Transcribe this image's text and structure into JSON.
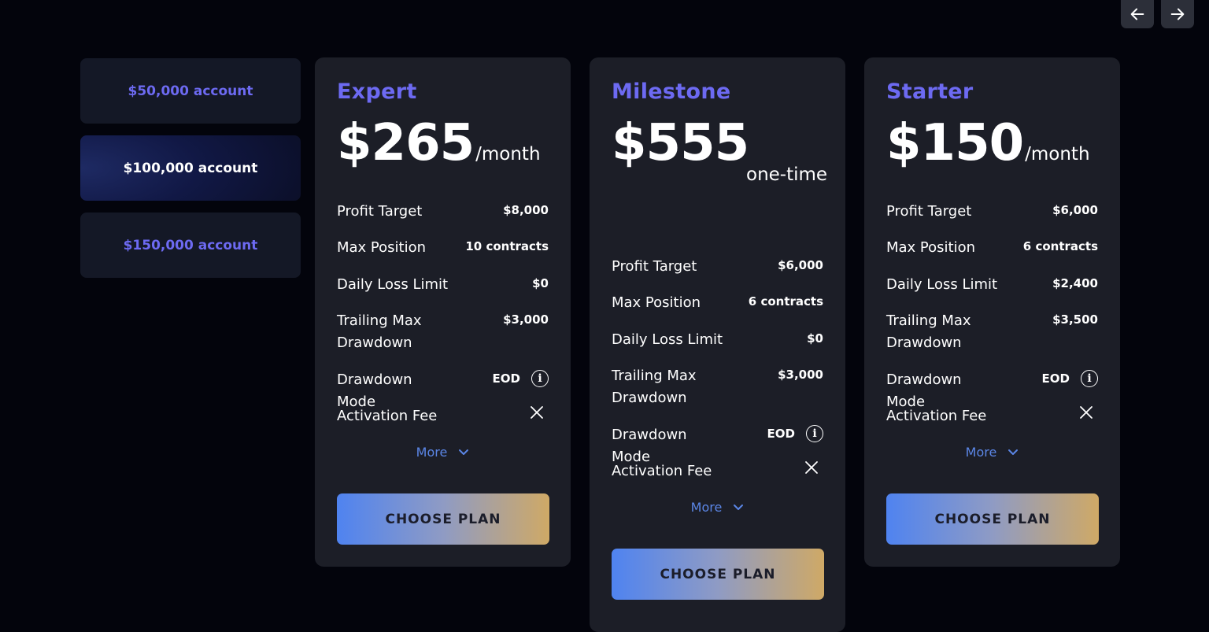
{
  "nav": {
    "prev_icon": "arrow-left-icon",
    "next_icon": "arrow-right-icon"
  },
  "accounts": [
    {
      "label": "$50,000 account",
      "active": false
    },
    {
      "label": "$100,000 account",
      "active": true
    },
    {
      "label": "$150,000 account",
      "active": false
    }
  ],
  "plans": [
    {
      "name": "Expert",
      "price": "$265",
      "period": "/month",
      "profit_target_label": "Profit Target",
      "profit_target": "$8,000",
      "max_position_label": "Max Position",
      "max_position": "10 contracts",
      "daily_loss_label": "Daily Loss Limit",
      "daily_loss": "$0",
      "trailing_label": "Trailing Max Drawdown",
      "trailing": "$3,000",
      "drawdown_mode_label": "Drawdown Mode",
      "drawdown_mode": "EOD",
      "activation_label": "Activation Fee",
      "more_label": "More",
      "cta": "CHOOSE PLAN"
    },
    {
      "name": "Milestone",
      "price": "$555",
      "period": "one-time",
      "profit_target_label": "Profit Target",
      "profit_target": "$6,000",
      "max_position_label": "Max Position",
      "max_position": "6 contracts",
      "daily_loss_label": "Daily Loss Limit",
      "daily_loss": "$0",
      "trailing_label": "Trailing Max Drawdown",
      "trailing": "$3,000",
      "drawdown_mode_label": "Drawdown Mode",
      "drawdown_mode": "EOD",
      "activation_label": "Activation Fee",
      "more_label": "More",
      "cta": "CHOOSE PLAN"
    },
    {
      "name": "Starter",
      "price": "$150",
      "period": "/month",
      "profit_target_label": "Profit Target",
      "profit_target": "$6,000",
      "max_position_label": "Max Position",
      "max_position": "6 contracts",
      "daily_loss_label": "Daily Loss Limit",
      "daily_loss": "$2,400",
      "trailing_label": "Trailing Max Drawdown",
      "trailing": "$3,500",
      "drawdown_mode_label": "Drawdown Mode",
      "drawdown_mode": "EOD",
      "activation_label": "Activation Fee",
      "more_label": "More",
      "cta": "CHOOSE PLAN"
    }
  ],
  "colors": {
    "accent": "#6d6af2",
    "link": "#5b86e6",
    "card_bg": "#1c1e27",
    "page_bg": "#03040c"
  }
}
